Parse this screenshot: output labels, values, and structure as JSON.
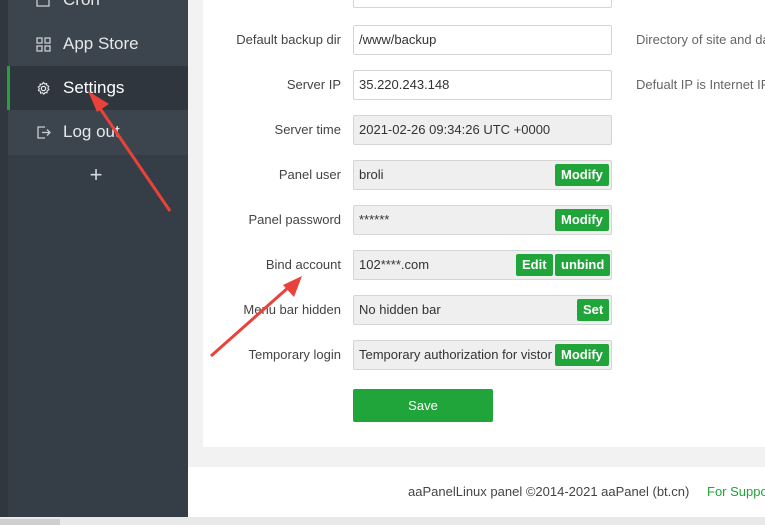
{
  "sidebar": {
    "items": [
      {
        "label": "Cron",
        "icon": "calendar-icon"
      },
      {
        "label": "App Store",
        "icon": "grid-icon"
      },
      {
        "label": "Settings",
        "icon": "gear-icon"
      },
      {
        "label": "Log out",
        "icon": "logout-icon"
      }
    ],
    "add_label": "+"
  },
  "settings": {
    "backup_dir": {
      "label": "Default backup dir",
      "value": "/www/backup",
      "hint": "Directory of site and da"
    },
    "server_ip": {
      "label": "Server IP",
      "value": "35.220.243.148",
      "hint": "Defualt IP is Internet IP"
    },
    "server_time": {
      "label": "Server time",
      "value": "2021-02-26 09:34:26 UTC +0000"
    },
    "panel_user": {
      "label": "Panel user",
      "value": "broli",
      "button": "Modify"
    },
    "panel_password": {
      "label": "Panel password",
      "value": "******",
      "button": "Modify"
    },
    "bind_account": {
      "label": "Bind account",
      "value": "102****.com",
      "edit_button": "Edit",
      "unbind_button": "unbind"
    },
    "menu_bar_hidden": {
      "label": "Menu bar hidden",
      "value": "No hidden bar",
      "button": "Set"
    },
    "temporary_login": {
      "label": "Temporary login",
      "value": "Temporary authorization for vistor",
      "button": "Modify"
    },
    "save_label": "Save"
  },
  "footer": {
    "copyright": "aaPanelLinux panel ©2014-2021 aaPanel (bt.cn)",
    "support": "For Suppo"
  },
  "colors": {
    "sidebar_bg": "#3c444d",
    "accent": "#20a53a",
    "annotation_arrow": "#e8423a"
  }
}
